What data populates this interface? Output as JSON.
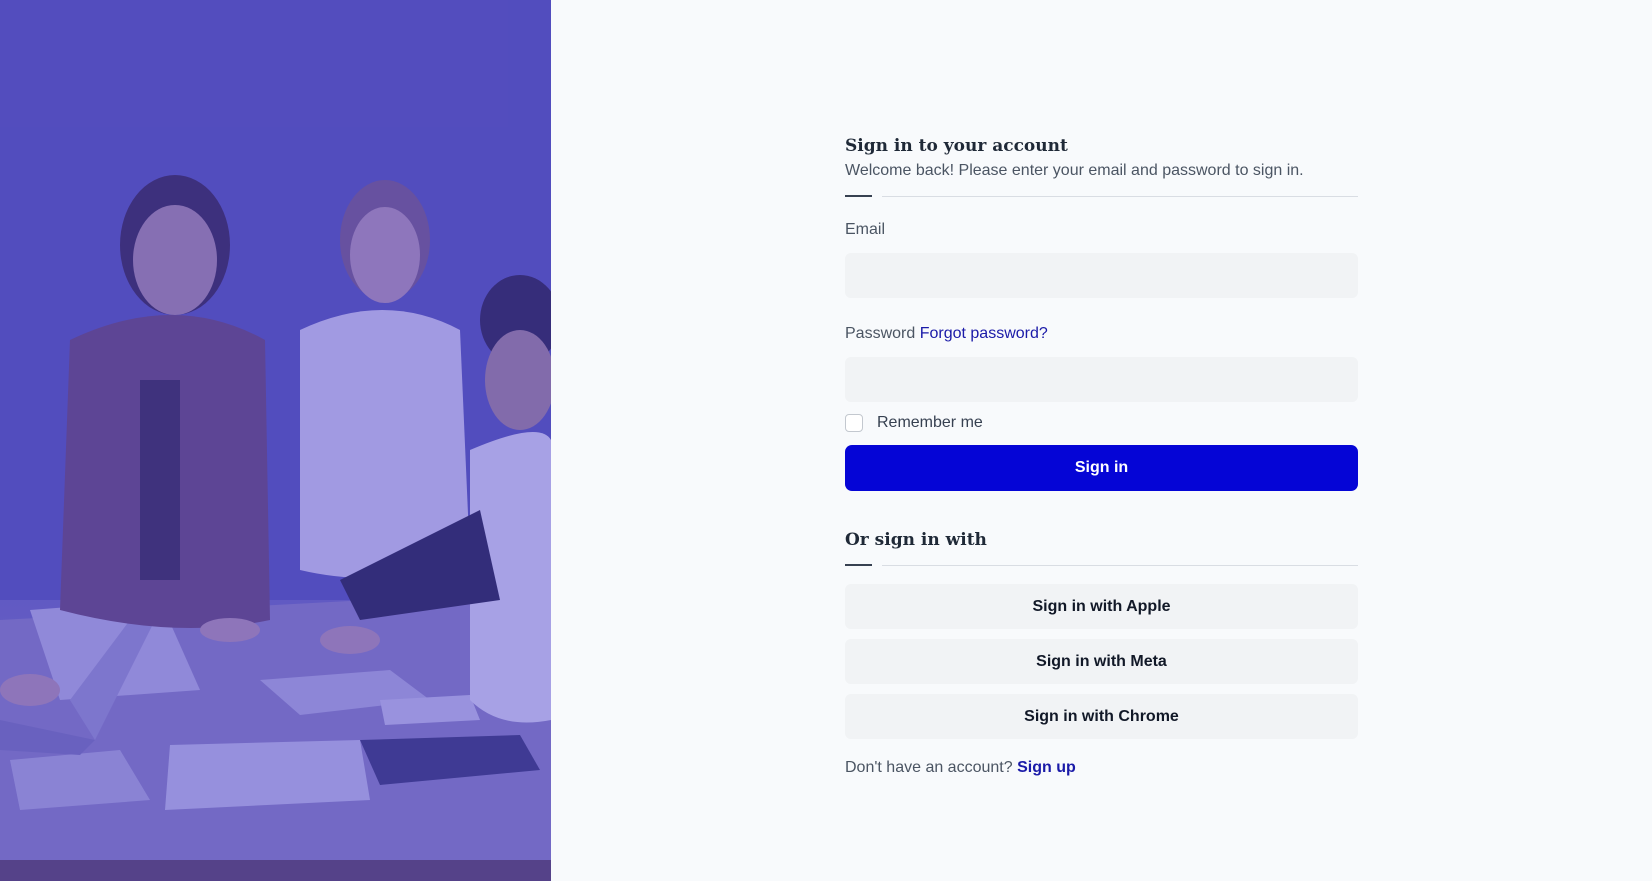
{
  "auth": {
    "title": "Sign in to your account",
    "subtitle": "Welcome back! Please enter your email and password to sign in.",
    "email_label": "Email",
    "email_value": "",
    "password_label": "Password",
    "password_value": "",
    "forgot_password": "Forgot password?",
    "remember_me": "Remember me",
    "remember_checked": false,
    "signin_button": "Sign in",
    "or_title": "Or sign in with",
    "social": [
      {
        "label": "Sign in with Apple"
      },
      {
        "label": "Sign in with Meta"
      },
      {
        "label": "Sign in with Chrome"
      }
    ],
    "no_account": "Don't have an account?",
    "signup_link": "Sign up"
  },
  "colors": {
    "primary": "#0505d6",
    "link": "#1a1aa8",
    "background": "#f8fafc",
    "input_bg": "#f1f3f5",
    "hero_tint": "#4a47a8"
  }
}
